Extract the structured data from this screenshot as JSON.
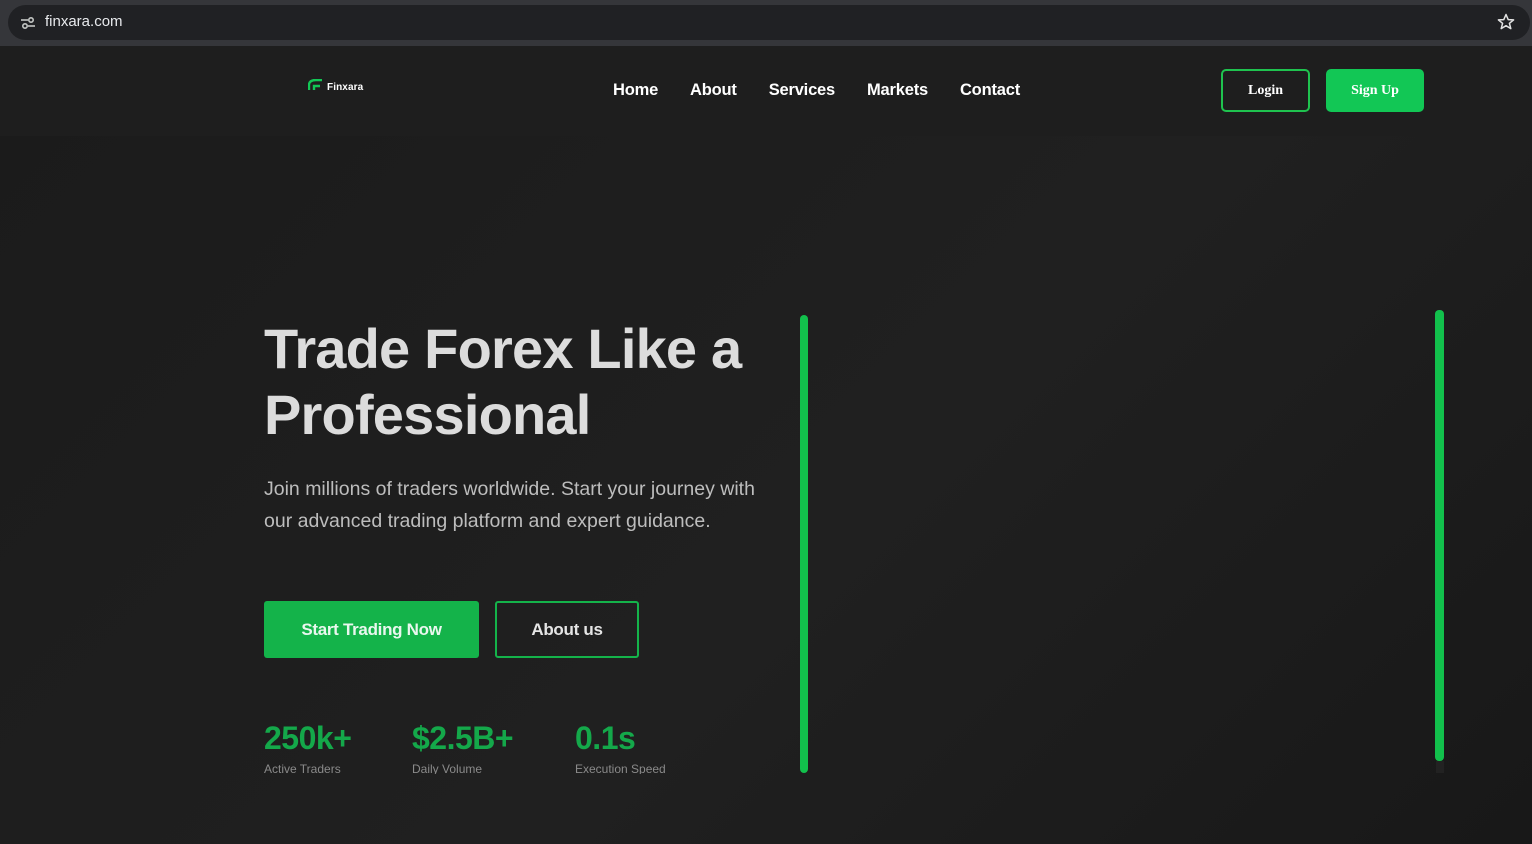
{
  "browser": {
    "url": "finxara.com"
  },
  "header": {
    "logo_text": "Finxara",
    "nav": [
      "Home",
      "About",
      "Services",
      "Markets",
      "Contact"
    ],
    "login_label": "Login",
    "signup_label": "Sign Up"
  },
  "hero": {
    "title": "Trade Forex Like a Professional",
    "subtitle": "Join millions of traders worldwide. Start your journey with our advanced trading platform and expert guidance.",
    "primary_cta": "Start Trading Now",
    "secondary_cta": "About us",
    "stats": [
      {
        "value": "250k+",
        "label": "Active Traders"
      },
      {
        "value": "$2.5B+",
        "label": "Daily Volume"
      },
      {
        "value": "0.1s",
        "label": "Execution Speed"
      }
    ]
  },
  "colors": {
    "accent": "#12c755",
    "background": "#1b1b1b",
    "header": "#1e1e1e"
  }
}
